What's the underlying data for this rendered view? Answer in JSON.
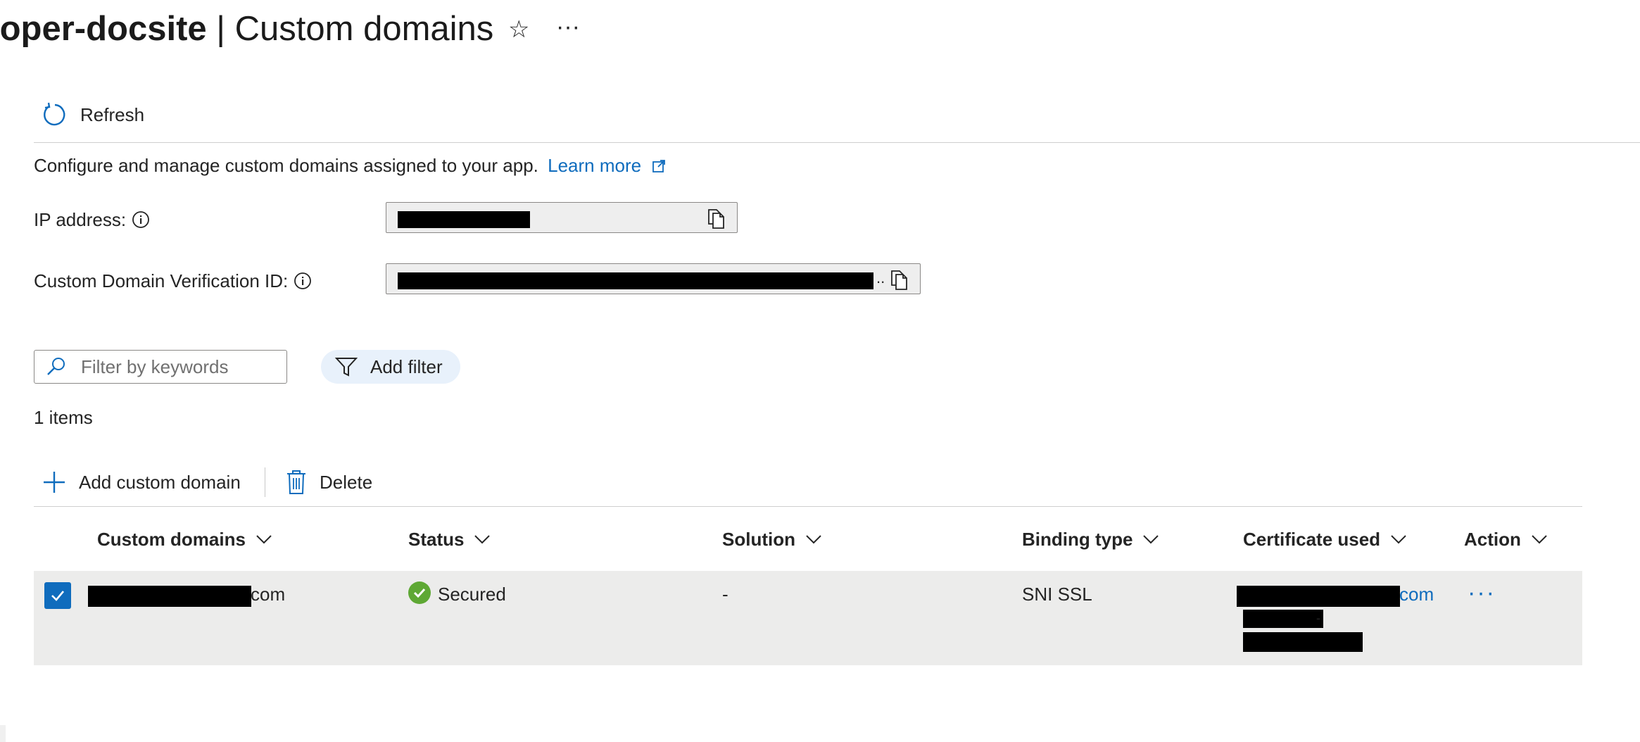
{
  "header": {
    "resource_name": "loper-docsite",
    "separator": " | ",
    "page_title": "Custom domains",
    "favorite_icon": "star-icon",
    "more_icon": "ellipsis-icon"
  },
  "commands": {
    "refresh_label": "Refresh"
  },
  "description": {
    "text": "Configure and manage custom domains assigned to your app.",
    "learn_more": "Learn more"
  },
  "fields": {
    "ip_address_label": "IP address:",
    "verification_id_label": "Custom Domain Verification ID:",
    "verification_truncation": ".."
  },
  "filter": {
    "placeholder": "Filter by keywords",
    "add_filter_label": "Add filter"
  },
  "items_count": "1 items",
  "toolbar": {
    "add_label": "Add custom domain",
    "delete_label": "Delete"
  },
  "table": {
    "columns": [
      "Custom domains",
      "Status",
      "Solution",
      "Binding type",
      "Certificate used",
      "Action"
    ],
    "rows": [
      {
        "selected": true,
        "domain_suffix": "com",
        "status": "Secured",
        "solution": "-",
        "binding_type": "SNI SSL",
        "certificate_suffix": "com",
        "certificate_extra": "-",
        "action": "···"
      }
    ]
  },
  "colors": {
    "accent": "#0f6cbd",
    "success": "#5ea834",
    "row_selected_bg": "#ececeb",
    "filter_pill_bg": "#e8f1fb"
  }
}
